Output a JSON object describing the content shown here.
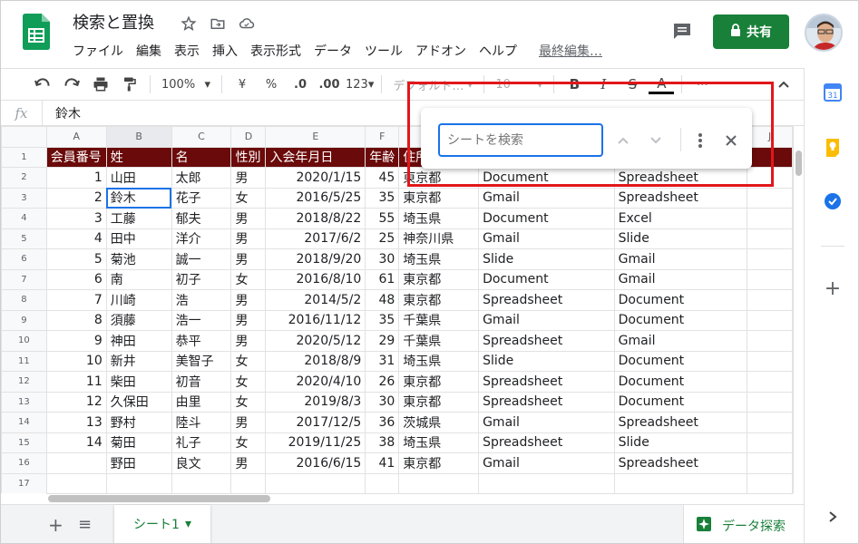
{
  "doc": {
    "title": "検索と置換"
  },
  "menu": [
    "ファイル",
    "編集",
    "表示",
    "挿入",
    "表示形式",
    "データ",
    "ツール",
    "アドオン",
    "ヘルプ"
  ],
  "last_edit": "最終編集…",
  "share": {
    "label": "共有"
  },
  "toolbar": {
    "zoom": "100%",
    "currency": "¥",
    "percent": "%",
    "dec_less": ".0",
    "dec_more": ".00",
    "format_more": "123",
    "font": "デフォルト…",
    "font_size": "10",
    "bold": "B",
    "italic": "I",
    "strike": "S",
    "text_color": "A",
    "more": "⋯"
  },
  "formula_bar": {
    "fx": "fx",
    "value": "鈴木"
  },
  "grid": {
    "columns": [
      "A",
      "B",
      "C",
      "D",
      "E",
      "F",
      "G",
      "H",
      "I",
      "J"
    ],
    "rows": [
      [
        "会員番号",
        "姓",
        "名",
        "性別",
        "入会年月日",
        "年齢",
        "住所",
        "",
        "",
        ""
      ],
      [
        "1",
        "山田",
        "太郎",
        "男",
        "2020/1/15",
        "45",
        "東京都",
        "Document",
        "Spreadsheet",
        ""
      ],
      [
        "2",
        "鈴木",
        "花子",
        "女",
        "2016/5/25",
        "35",
        "東京都",
        "Gmail",
        "Spreadsheet",
        ""
      ],
      [
        "3",
        "工藤",
        "郁夫",
        "男",
        "2018/8/22",
        "55",
        "埼玉県",
        "Document",
        "Excel",
        ""
      ],
      [
        "4",
        "田中",
        "洋介",
        "男",
        "2017/6/2",
        "25",
        "神奈川県",
        "Gmail",
        "Slide",
        ""
      ],
      [
        "5",
        "菊池",
        "誠一",
        "男",
        "2018/9/20",
        "30",
        "埼玉県",
        "Slide",
        "Gmail",
        ""
      ],
      [
        "6",
        "南",
        "初子",
        "女",
        "2016/8/10",
        "61",
        "東京都",
        "Document",
        "Gmail",
        ""
      ],
      [
        "7",
        "川崎",
        "浩",
        "男",
        "2014/5/2",
        "48",
        "東京都",
        "Spreadsheet",
        "Document",
        ""
      ],
      [
        "8",
        "須藤",
        "浩一",
        "男",
        "2016/11/12",
        "35",
        "千葉県",
        "Gmail",
        "Document",
        ""
      ],
      [
        "9",
        "神田",
        "恭平",
        "男",
        "2020/5/12",
        "29",
        "千葉県",
        "Spreadsheet",
        "Gmail",
        ""
      ],
      [
        "10",
        "新井",
        "美智子",
        "女",
        "2018/8/9",
        "31",
        "埼玉県",
        "Slide",
        "Document",
        ""
      ],
      [
        "11",
        "柴田",
        "初音",
        "女",
        "2020/4/10",
        "26",
        "東京都",
        "Spreadsheet",
        "Document",
        ""
      ],
      [
        "12",
        "久保田",
        "由里",
        "女",
        "2019/8/3",
        "30",
        "東京都",
        "Spreadsheet",
        "Document",
        ""
      ],
      [
        "13",
        "野村",
        "陸斗",
        "男",
        "2017/12/5",
        "36",
        "茨城県",
        "Gmail",
        "Spreadsheet",
        ""
      ],
      [
        "14",
        "菊田",
        "礼子",
        "女",
        "2019/11/25",
        "38",
        "埼玉県",
        "Spreadsheet",
        "Slide",
        ""
      ],
      [
        "",
        "野田",
        "良文",
        "男",
        "2016/6/15",
        "41",
        "東京都",
        "Gmail",
        "Spreadsheet",
        ""
      ],
      [
        "",
        "",
        "",
        "",
        "",
        "",
        "",
        "",
        "",
        ""
      ]
    ]
  },
  "find": {
    "placeholder": "シートを検索"
  },
  "sheet_tab": {
    "label": "シート1"
  },
  "explore": {
    "label": "データ探索"
  },
  "colors": {
    "header_fill": "#6b0a0a",
    "accent": "#188038",
    "highlight": "#e2171b",
    "selection": "#1a73e8"
  }
}
